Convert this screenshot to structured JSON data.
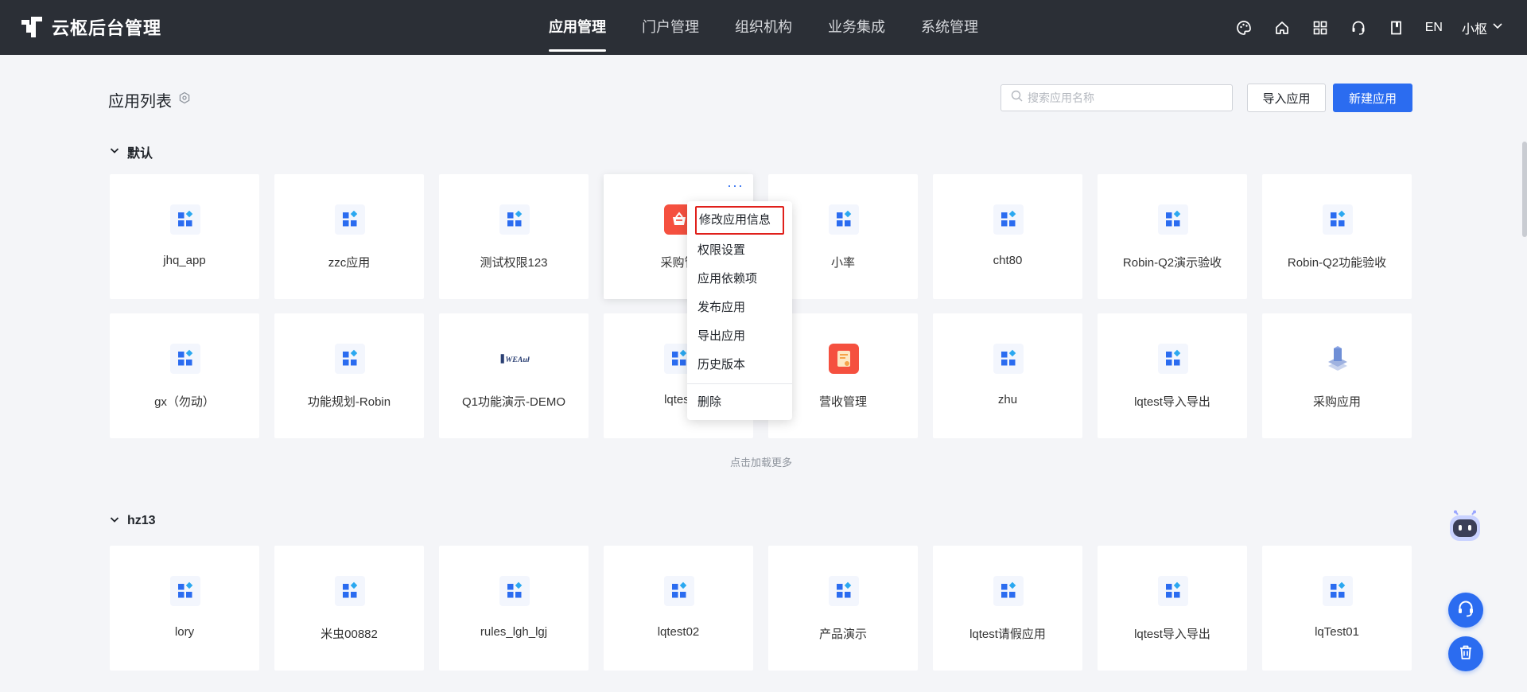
{
  "header": {
    "brand_title": "云枢后台管理",
    "nav": [
      {
        "label": "应用管理",
        "active": true
      },
      {
        "label": "门户管理",
        "active": false
      },
      {
        "label": "组织机构",
        "active": false
      },
      {
        "label": "业务集成",
        "active": false
      },
      {
        "label": "系统管理",
        "active": false
      }
    ],
    "tools": [
      "palette-icon",
      "home-icon",
      "apps-grid-icon",
      "headset-icon",
      "book-icon"
    ],
    "lang": "EN",
    "user_name": "小枢"
  },
  "page": {
    "title": "应用列表",
    "search_placeholder": "搜索应用名称",
    "import_label": "导入应用",
    "new_label": "新建应用",
    "load_more": "点击加载更多"
  },
  "groups": [
    {
      "name": "默认",
      "apps": [
        {
          "name": "jhq_app",
          "icon": "grid-app-icon"
        },
        {
          "name": "zzc应用",
          "icon": "grid-app-icon"
        },
        {
          "name": "测试权限123",
          "icon": "grid-app-icon"
        },
        {
          "name": "采购管",
          "icon": "basket-app-icon"
        },
        {
          "name": "小率",
          "icon": "grid-app-icon"
        },
        {
          "name": "cht80",
          "icon": "grid-app-icon"
        },
        {
          "name": "Robin-Q2演示验收",
          "icon": "grid-app-icon"
        },
        {
          "name": "Robin-Q2功能验收",
          "icon": "grid-app-icon"
        },
        {
          "name": "gx（勿动）",
          "icon": "grid-app-icon"
        },
        {
          "name": "功能规划-Robin",
          "icon": "grid-app-icon"
        },
        {
          "name": "Q1功能演示-DEMO",
          "icon": "logo-app-icon"
        },
        {
          "name": "lqtest",
          "icon": "grid-app-icon"
        },
        {
          "name": "营收管理",
          "icon": "document-app-icon"
        },
        {
          "name": "zhu",
          "icon": "grid-app-icon"
        },
        {
          "name": "lqtest导入导出",
          "icon": "grid-app-icon"
        },
        {
          "name": "采购应用",
          "icon": "stack-app-icon"
        }
      ]
    },
    {
      "name": "hz13",
      "apps": [
        {
          "name": "lory",
          "icon": "grid-app-icon"
        },
        {
          "name": "米虫00882",
          "icon": "grid-app-icon"
        },
        {
          "name": "rules_lgh_lgj",
          "icon": "grid-app-icon"
        },
        {
          "name": "lqtest02",
          "icon": "grid-app-icon"
        },
        {
          "name": "产品演示",
          "icon": "grid-app-icon"
        },
        {
          "name": "lqtest请假应用",
          "icon": "grid-app-icon"
        },
        {
          "name": "lqtest导入导出",
          "icon": "grid-app-icon"
        },
        {
          "name": "lqTest01",
          "icon": "grid-app-icon"
        }
      ]
    }
  ],
  "context_menu": {
    "items": [
      "修改应用信息",
      "权限设置",
      "应用依赖项",
      "发布应用",
      "导出应用",
      "历史版本"
    ],
    "danger": "删除",
    "more_glyph": "···"
  },
  "colors": {
    "topbar": "#2b2f36",
    "primary": "#2b6cf0",
    "highlight_box": "#e0201b"
  }
}
